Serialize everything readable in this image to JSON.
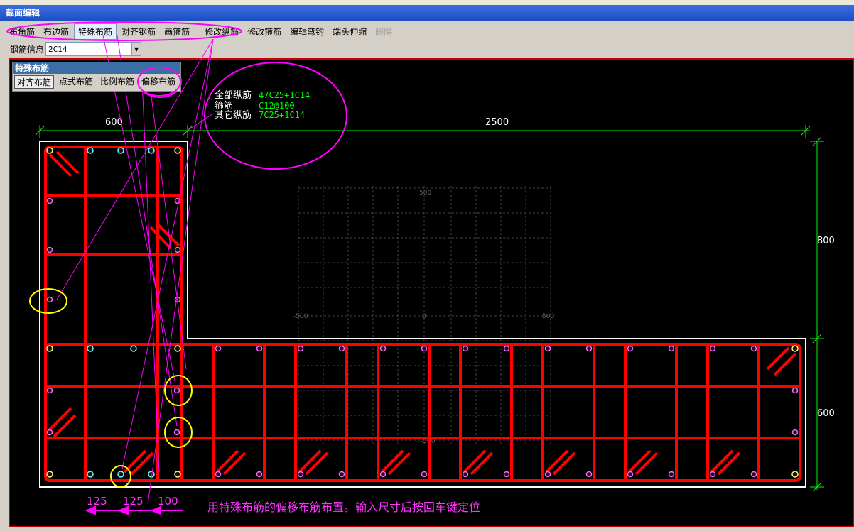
{
  "window": {
    "title": "截面编辑"
  },
  "toolbar": {
    "items": [
      {
        "label": "布角筋",
        "state": "normal"
      },
      {
        "label": "布边筋",
        "state": "normal"
      },
      {
        "label": "特殊布筋",
        "state": "active"
      },
      {
        "label": "对齐钢筋",
        "state": "normal"
      },
      {
        "label": "画箍筋",
        "state": "normal"
      },
      {
        "label": "修改纵筋",
        "state": "normal"
      },
      {
        "label": "修改箍筋",
        "state": "normal"
      },
      {
        "label": "编辑弯钩",
        "state": "normal"
      },
      {
        "label": "端头伸缩",
        "state": "normal"
      },
      {
        "label": "删除",
        "state": "disabled"
      }
    ]
  },
  "rebar_info": {
    "label": "钢筋信息",
    "value": "2C14"
  },
  "special_panel": {
    "title": "特殊布筋",
    "buttons": [
      "对齐布筋",
      "点式布筋",
      "比例布筋",
      "偏移布筋"
    ]
  },
  "info": {
    "rows": [
      {
        "label": "全部纵筋",
        "value": "47C25+1C14"
      },
      {
        "label": "箍筋",
        "value": "C12@100"
      },
      {
        "label": "其它纵筋",
        "value": "7C25+1C14"
      }
    ]
  },
  "dimensions": {
    "top_left": "600",
    "top_right": "2500",
    "right_upper": "800",
    "right_lower": "600",
    "bottom": [
      "125",
      "125",
      "100"
    ]
  },
  "grid_labels": {
    "top": "500",
    "left": "-500",
    "center": "0",
    "right": "500",
    "bottom": "-500"
  },
  "hint": "用特殊布筋的偏移布筋布置。输入尺寸后按回车键定位",
  "colors": {
    "rebar": "#ff0000",
    "dim": "#00ff00",
    "annotation": "#ff00ff",
    "highlight": "#ffff00",
    "outline": "#ffffff"
  }
}
